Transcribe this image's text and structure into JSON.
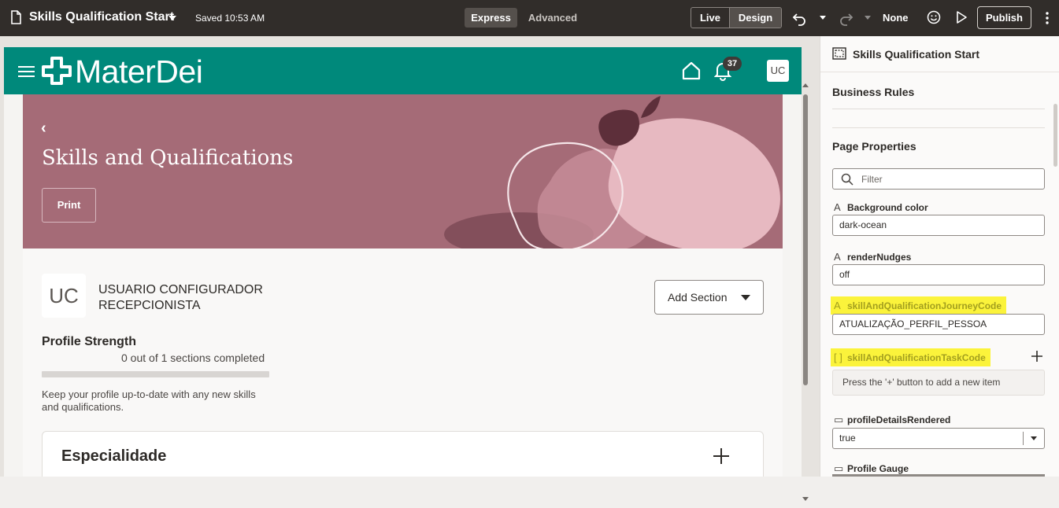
{
  "topbar": {
    "title": "Skills Qualification Start",
    "saved": "Saved 10:53 AM",
    "mode_express": "Express",
    "mode_advanced": "Advanced",
    "view_live": "Live",
    "view_design": "Design",
    "device": "None",
    "publish": "Publish"
  },
  "app": {
    "logo_text": "MaterDei",
    "notification_count": "37",
    "avatar_initials": "UC"
  },
  "hero": {
    "title": "Skills and Qualifications",
    "print_label": "Print",
    "back_glyph": "‹"
  },
  "profile": {
    "avatar_initials": "UC",
    "name": "USUARIO CONFIGURADOR RECEPCIONISTA",
    "add_section_label": "Add Section",
    "strength_title": "Profile Strength",
    "strength_progress": "0 out of 1 sections completed",
    "strength_fraction": 0,
    "strength_desc": "Keep your profile up-to-date with any new skills and qualifications."
  },
  "section": {
    "title": "Especialidade"
  },
  "panel": {
    "title": "Skills Qualification Start",
    "business_rules": "Business Rules",
    "page_properties": "Page Properties",
    "filter_placeholder": "Filter",
    "props": {
      "background_color_label": "Background color",
      "background_color_value": "dark-ocean",
      "render_nudges_label": "renderNudges",
      "render_nudges_value": "off",
      "journey_code_label": "skillAndQualificationJourneyCode",
      "journey_code_value": "ATUALIZAÇÃO_PERFIL_PESSOA",
      "task_code_label": "skillAndQualificationTaskCode",
      "task_code_empty": "Press the '+' button to add a new item",
      "profile_details_label": "profileDetailsRendered",
      "profile_details_value": "true",
      "profile_gauge_label": "Profile Gauge"
    }
  },
  "colors": {
    "topbar": "#312d2a",
    "brand_teal": "#00897b",
    "hero_rose": "#a56b77",
    "highlight": "#fbf33b"
  },
  "icons": [
    "document-icon",
    "undo-icon",
    "redo-icon",
    "smile-icon",
    "play-icon",
    "more-icon",
    "hamburger-icon",
    "logo-cross-icon",
    "home-icon",
    "bell-icon",
    "chevron-left-icon",
    "caret-down-icon",
    "plus-icon",
    "search-icon",
    "text-type-icon",
    "array-type-icon",
    "boolean-type-icon",
    "page-icon"
  ]
}
